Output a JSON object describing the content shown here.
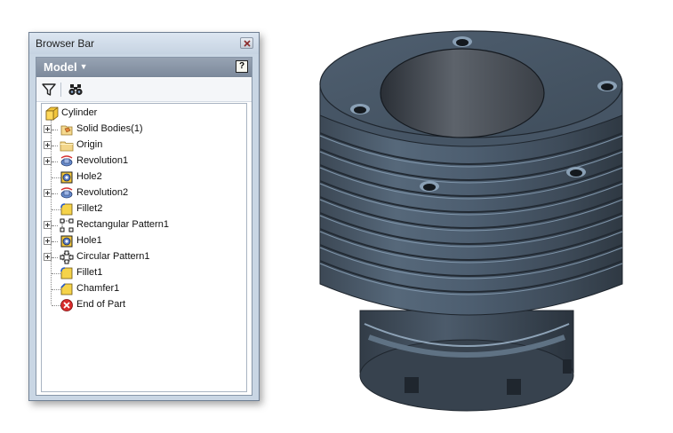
{
  "window": {
    "title": "Browser Bar"
  },
  "panel": {
    "header": "Model",
    "help_label": "?"
  },
  "toolbar": {
    "filter_icon": "filter-icon",
    "find_icon": "binoculars-icon"
  },
  "tree": {
    "root": {
      "label": "Cylinder",
      "icon": "part-icon"
    },
    "items": [
      {
        "label": "Solid Bodies(1)",
        "icon": "solid-bodies-icon",
        "expandable": true
      },
      {
        "label": "Origin",
        "icon": "folder-icon",
        "expandable": true
      },
      {
        "label": "Revolution1",
        "icon": "revolve-icon",
        "expandable": true
      },
      {
        "label": "Hole2",
        "icon": "hole-icon",
        "expandable": false
      },
      {
        "label": "Revolution2",
        "icon": "revolve-icon",
        "expandable": true
      },
      {
        "label": "Fillet2",
        "icon": "fillet-icon",
        "expandable": false
      },
      {
        "label": "Rectangular Pattern1",
        "icon": "rectangular-pattern-icon",
        "expandable": true
      },
      {
        "label": "Hole1",
        "icon": "hole-icon",
        "expandable": true
      },
      {
        "label": "Circular Pattern1",
        "icon": "circular-pattern-icon",
        "expandable": true
      },
      {
        "label": "Fillet1",
        "icon": "fillet-icon",
        "expandable": false
      },
      {
        "label": "Chamfer1",
        "icon": "chamfer-icon",
        "expandable": false
      },
      {
        "label": "End of Part",
        "icon": "end-of-part-icon",
        "expandable": false
      }
    ]
  },
  "viewport": {
    "model_color": "#4a5866",
    "model_icon": "cylinder-model"
  }
}
